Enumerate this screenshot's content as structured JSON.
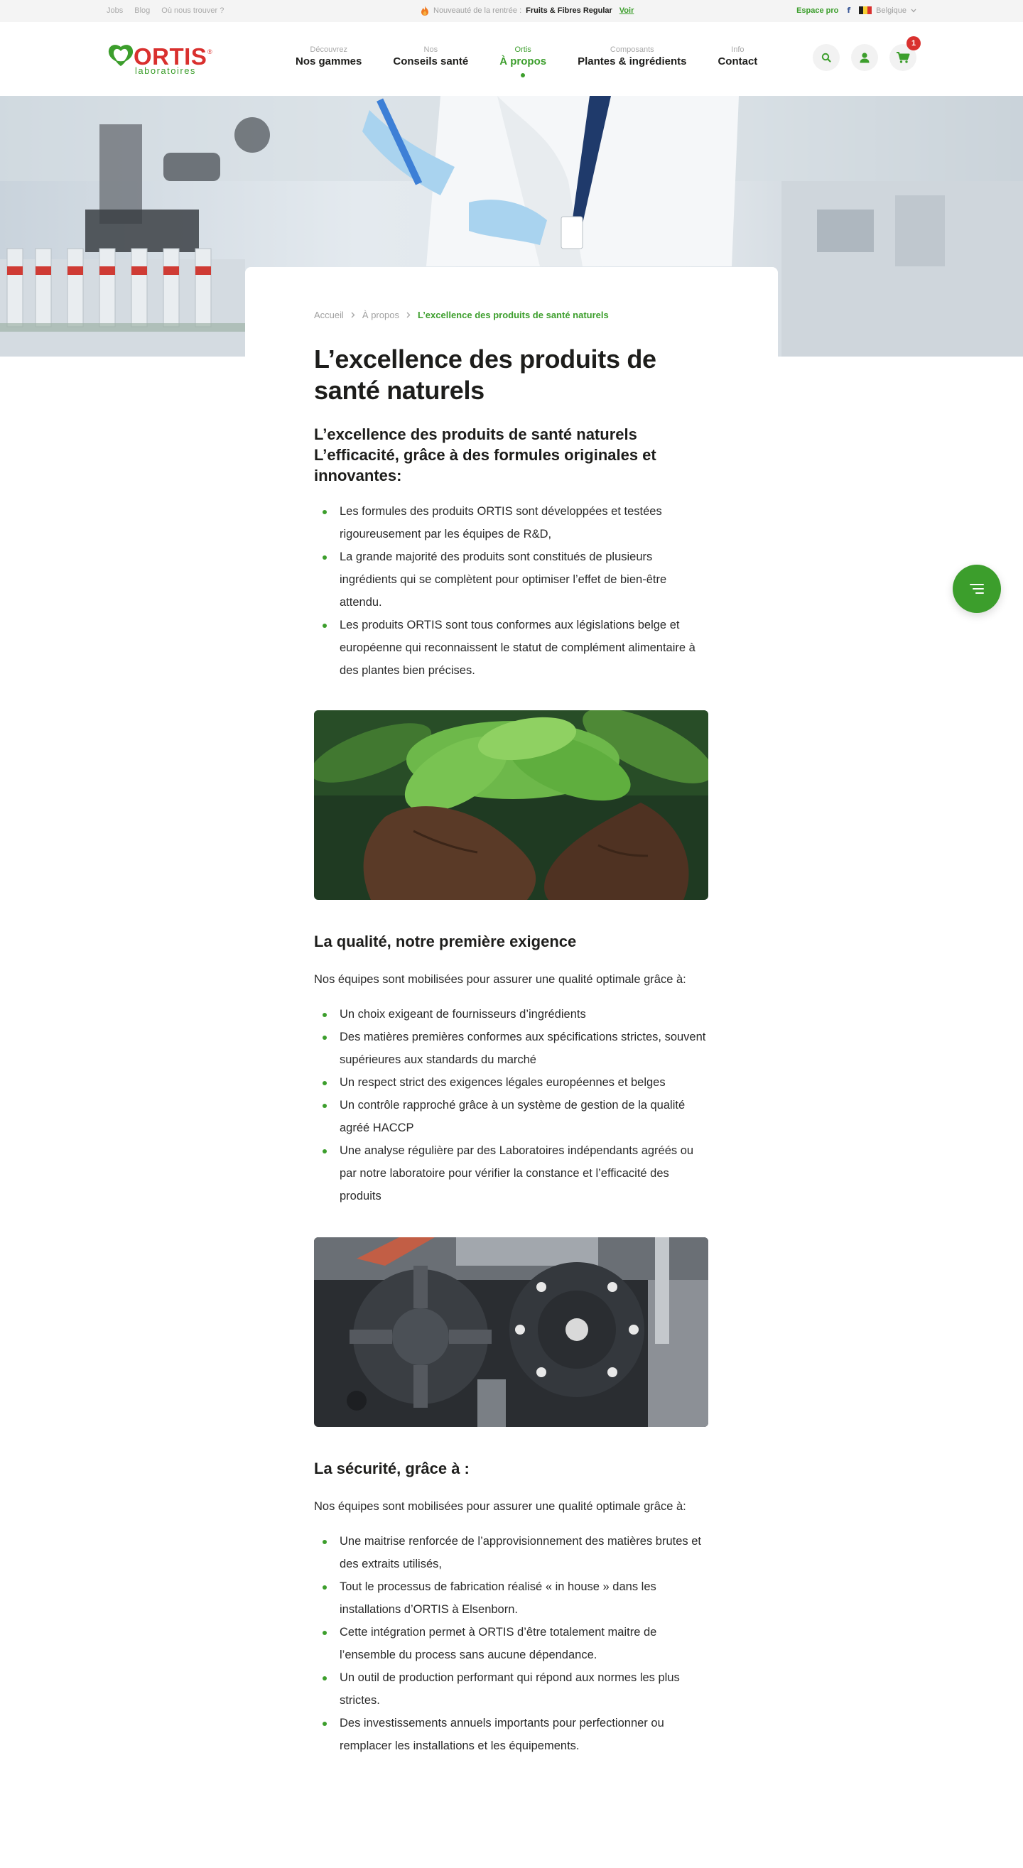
{
  "topbar": {
    "links": [
      "Jobs",
      "Blog",
      "Où nous trouver ?"
    ],
    "news_label": "Nouveauté de la rentrée :",
    "news_product": "Fruits & Fibres Regular",
    "news_link": "Voir",
    "pro_link": "Espace pro",
    "facebook": "f",
    "country": "Belgique"
  },
  "header": {
    "logo_word": "ORTIS",
    "logo_sub": "laboratoires",
    "logo_reg": "®",
    "nav": [
      {
        "kicker": "Découvrez",
        "title": "Nos gammes"
      },
      {
        "kicker": "Nos",
        "title": "Conseils santé"
      },
      {
        "kicker": "Ortis",
        "title": "À propos",
        "active": true
      },
      {
        "kicker": "Composants",
        "title": "Plantes & ingrédients"
      },
      {
        "kicker": "Info",
        "title": "Contact"
      }
    ],
    "cart_count": "1"
  },
  "breadcrumb": {
    "home": "Accueil",
    "about": "À propos",
    "current": "L’excellence des produits de santé naturels"
  },
  "article": {
    "title": "L’excellence des produits de santé naturels",
    "lead": "L’excellence des produits de santé naturels L’efficacité, grâce à des formules originales et innovantes:",
    "list1": [
      "Les formules des produits ORTIS sont développées et testées rigoureusement par les équipes de R&D,",
      "La grande majorité des produits sont constitués de plusieurs ingrédients qui se complètent pour optimiser l’effet de bien-être attendu.",
      "Les produits ORTIS sont tous conformes aux législations belge et européenne qui reconnaissent le statut de complément alimentaire à des plantes bien précises."
    ],
    "quality_title": "La qualité, notre première exigence",
    "quality_intro": "Nos équipes sont mobilisées pour assurer une qualité optimale grâce à:",
    "list2": [
      "Un choix exigeant de fournisseurs d’ingrédients",
      "Des matières premières conformes aux spécifications strictes, souvent supérieures aux standards du marché",
      "Un respect strict des exigences légales européennes et belges",
      "Un contrôle rapproché grâce à un système de gestion de la qualité agréé HACCP",
      "Une analyse régulière par des Laboratoires indépendants agréés ou par notre laboratoire pour vérifier la constance et l’efficacité des produits"
    ],
    "security_title": "La sécurité, grâce à :",
    "security_intro": "Nos équipes sont mobilisées pour assurer une qualité optimale grâce à:",
    "list3": [
      "Une maitrise renforcée de l’approvisionnement des matières brutes et des extraits utilisés,",
      "Tout le processus de fabrication réalisé « in house » dans les installations d’ORTIS à Elsenborn.",
      "Cette intégration permet à ORTIS d’être totalement maitre de l’ensemble du process sans aucune dépendance.",
      "Un outil de production performant qui répond aux normes les plus strictes.",
      "Des investissements annuels importants pour perfectionner ou remplacer les installations et les équipements."
    ]
  },
  "colors": {
    "brand_green": "#3c9e2c",
    "brand_red": "#d9302e",
    "text": "#1d1d1b"
  },
  "icons": [
    "flame-icon",
    "facebook-icon",
    "belgium-flag-icon",
    "chevron-down-icon",
    "search-icon",
    "user-icon",
    "cart-icon",
    "chevron-right-icon",
    "menu-icon"
  ]
}
